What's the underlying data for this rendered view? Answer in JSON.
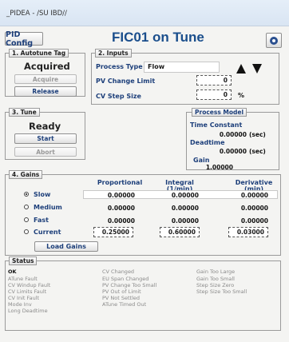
{
  "window": {
    "title": "_PIDEA - /SU IBD//"
  },
  "header": {
    "config_label": "PID Config",
    "page_title": "FIC01 on Tune",
    "settings_icon": "gear-icon"
  },
  "autotune": {
    "group_label": "1. Autotune Tag",
    "status": "Acquired",
    "acquire_label": "Acquire",
    "release_label": "Release"
  },
  "inputs": {
    "group_label": "2. Inputs",
    "process_type_label": "Process Type",
    "process_type_value": "Flow",
    "pv_change_label": "PV Change Limit",
    "pv_change_value": "0",
    "cv_step_label": "CV Step Size",
    "cv_step_value": "0",
    "cv_step_unit": "%"
  },
  "tune": {
    "group_label": "3. Tune",
    "status": "Ready",
    "start_label": "Start",
    "abort_label": "Abort"
  },
  "process_model": {
    "title": "Process Model",
    "time_constant_label": "Time Constant",
    "time_constant_value": "0.00000",
    "time_constant_unit": "(sec)",
    "deadtime_label": "Deadtime",
    "deadtime_value": "0.00000",
    "deadtime_unit": "(sec)",
    "gain_label": "Gain",
    "gain_value": "1.00000"
  },
  "gains": {
    "group_label": "4. Gains",
    "col_proportional": "Proportional",
    "col_integral": "Integral",
    "col_integral_unit": "(1/min)",
    "col_derivative": "Derivative",
    "col_derivative_unit": "(min)",
    "rows": [
      {
        "label": "Slow",
        "p": "0.00000",
        "i": "0.00000",
        "d": "0.00000",
        "selected": true
      },
      {
        "label": "Medium",
        "p": "0.00000",
        "i": "0.00000",
        "d": "0.00000",
        "selected": false
      },
      {
        "label": "Fast",
        "p": "0.00000",
        "i": "0.00000",
        "d": "0.00000",
        "selected": false
      },
      {
        "label": "Current",
        "p": "0.25000",
        "i": "0.60000",
        "d": "0.03000",
        "selected": false
      }
    ],
    "load_label": "Load Gains"
  },
  "status": {
    "group_label": "Status",
    "col1": [
      "OK",
      "ATune Fault",
      "CV Windup Fault",
      "CV Limits Fault",
      "CV Init Fault",
      "Mode Inv",
      "Long Deadtime"
    ],
    "col2": [
      "CV Changed",
      "EU Span Changed",
      "PV Change Too Small",
      "PV Out of Limit",
      "PV Not Settled",
      "ATune Timed Out"
    ],
    "col3": [
      "Gain Too Large",
      "Gain Too Small",
      "Step Size Zero",
      "Step Size Too Small"
    ]
  },
  "colors": {
    "accent": "#1d3f7a",
    "title": "#1a4e8c"
  }
}
